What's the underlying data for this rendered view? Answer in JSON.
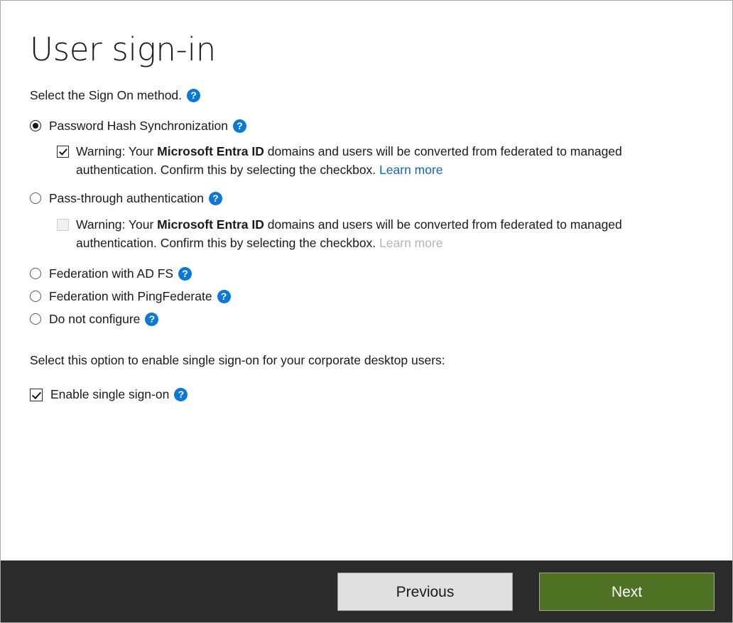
{
  "page": {
    "title": "User sign-in",
    "intro": "Select the Sign On method.",
    "help_icon_glyph": "?"
  },
  "options": [
    {
      "label": "Password Hash Synchronization",
      "selected": true,
      "help": "?"
    },
    {
      "label": "Pass-through authentication",
      "selected": false,
      "help": "?"
    },
    {
      "label": "Federation with AD FS",
      "selected": false,
      "help": "?"
    },
    {
      "label": "Federation with PingFederate",
      "selected": false,
      "help": "?"
    },
    {
      "label": "Do not configure",
      "selected": false,
      "help": "?"
    }
  ],
  "warnings": {
    "first": {
      "checked": true,
      "enabled": true,
      "prefix": "Warning: Your ",
      "emphasis": "Microsoft Entra ID",
      "body": " domains and users will be converted from federated to managed authentication. Confirm this by selecting the checkbox. ",
      "link": "Learn more"
    },
    "second": {
      "checked": false,
      "enabled": false,
      "prefix": "Warning: Your ",
      "emphasis": "Microsoft Entra ID",
      "body": " domains and users will be converted from federated to managed authentication. Confirm this by selecting the checkbox. ",
      "link": "Learn more"
    }
  },
  "sso": {
    "intro": "Select this option to enable single sign-on for your corporate desktop users:",
    "checkbox_label": "Enable single sign-on",
    "checked": true,
    "help": "?"
  },
  "footer": {
    "previous_label": "Previous",
    "next_label": "Next"
  },
  "colors": {
    "accent_blue": "#0a78d4",
    "link_blue": "#1765b5",
    "link_disabled": "#b6b6b6",
    "footer_bg": "#2b2b2b",
    "next_green": "#4f7124",
    "previous_gray": "#e0e0e0",
    "text": "#1a1a1a"
  }
}
